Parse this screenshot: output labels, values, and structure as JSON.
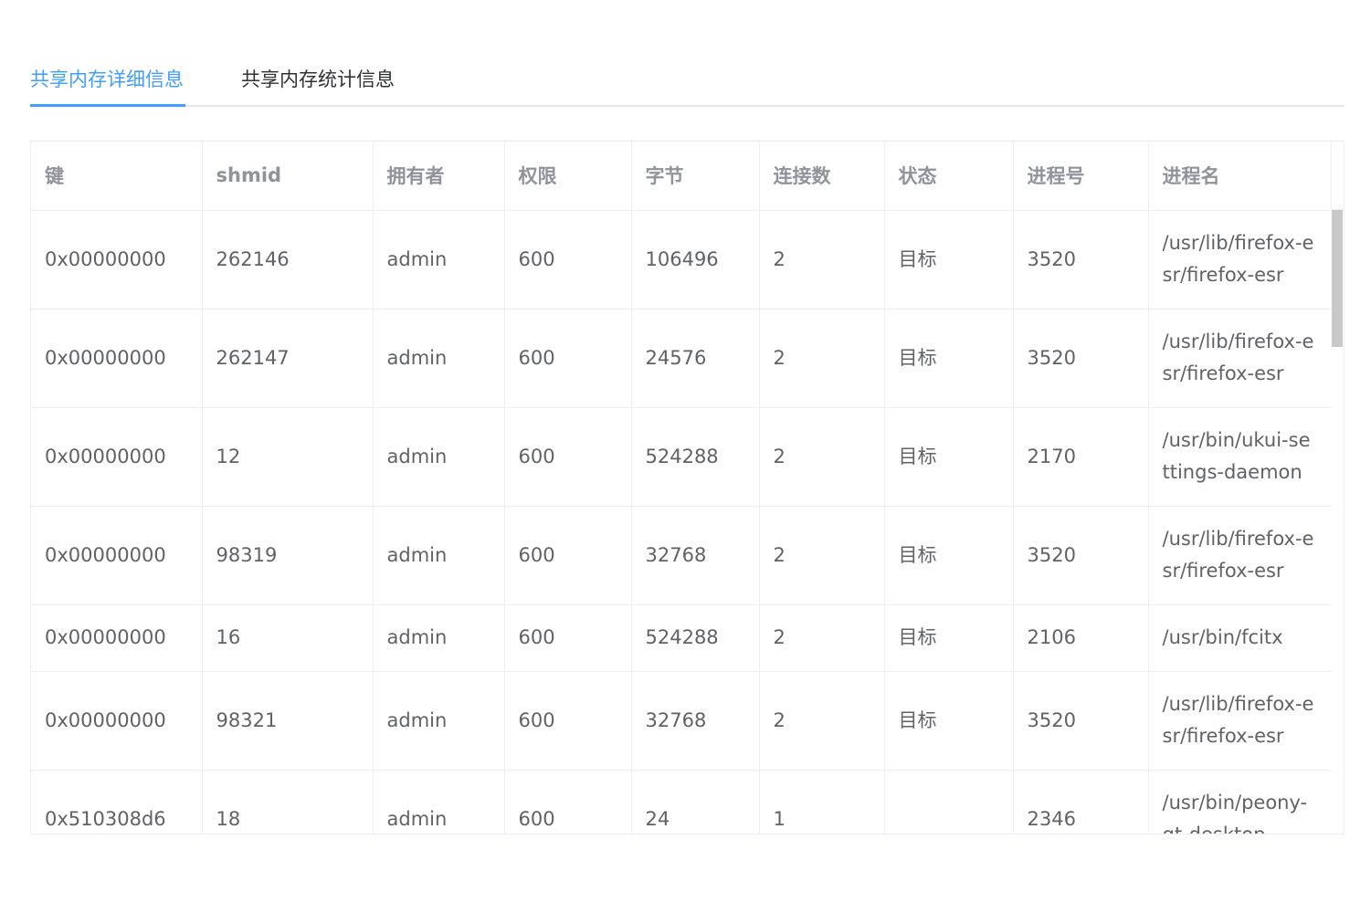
{
  "tabs": [
    {
      "label": "共享内存详细信息",
      "active": true
    },
    {
      "label": "共享内存统计信息",
      "active": false
    }
  ],
  "colors": {
    "accent": "#409eff",
    "header_text": "#909399",
    "cell_text": "#606266",
    "border": "#ebeef5"
  },
  "table": {
    "columns": [
      "键",
      "shmid",
      "拥有者",
      "权限",
      "字节",
      "连接数",
      "状态",
      "进程号",
      "进程名"
    ],
    "rows": [
      {
        "key": "0x00000000",
        "shmid": "262146",
        "owner": "admin",
        "perms": "600",
        "bytes": "106496",
        "nattch": "2",
        "status": "目标",
        "pid": "3520",
        "process": "/usr/lib/firefox-esr/firefox-esr"
      },
      {
        "key": "0x00000000",
        "shmid": "262147",
        "owner": "admin",
        "perms": "600",
        "bytes": "24576",
        "nattch": "2",
        "status": "目标",
        "pid": "3520",
        "process": "/usr/lib/firefox-esr/firefox-esr"
      },
      {
        "key": "0x00000000",
        "shmid": "12",
        "owner": "admin",
        "perms": "600",
        "bytes": "524288",
        "nattch": "2",
        "status": "目标",
        "pid": "2170",
        "process": "/usr/bin/ukui-settings-daemon"
      },
      {
        "key": "0x00000000",
        "shmid": "98319",
        "owner": "admin",
        "perms": "600",
        "bytes": "32768",
        "nattch": "2",
        "status": "目标",
        "pid": "3520",
        "process": "/usr/lib/firefox-esr/firefox-esr"
      },
      {
        "key": "0x00000000",
        "shmid": "16",
        "owner": "admin",
        "perms": "600",
        "bytes": "524288",
        "nattch": "2",
        "status": "目标",
        "pid": "2106",
        "process": "/usr/bin/fcitx"
      },
      {
        "key": "0x00000000",
        "shmid": "98321",
        "owner": "admin",
        "perms": "600",
        "bytes": "32768",
        "nattch": "2",
        "status": "目标",
        "pid": "3520",
        "process": "/usr/lib/firefox-esr/firefox-esr"
      },
      {
        "key": "0x510308d6",
        "shmid": "18",
        "owner": "admin",
        "perms": "600",
        "bytes": "24",
        "nattch": "1",
        "status": "",
        "pid": "2346",
        "process": "/usr/bin/peony-qt-desktop"
      }
    ]
  }
}
